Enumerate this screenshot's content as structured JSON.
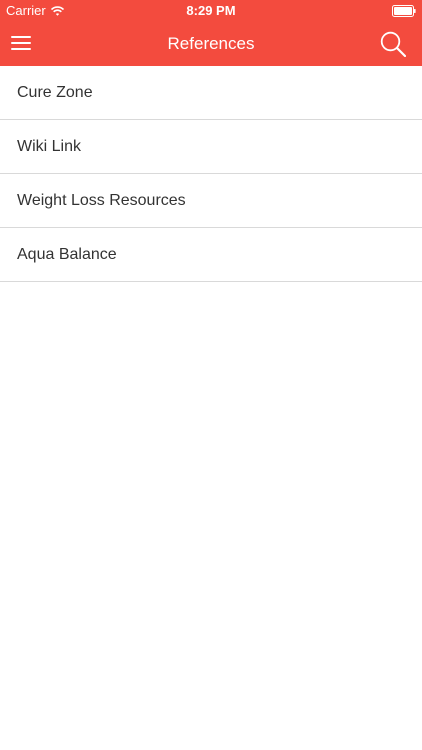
{
  "status_bar": {
    "carrier": "Carrier",
    "time": "8:29 PM",
    "wifi_icon": "wifi-icon",
    "battery_icon": "battery-icon"
  },
  "header": {
    "title": "References",
    "menu_icon": "hamburger-menu-icon",
    "search_icon": "search-icon",
    "background_color": "#f34b3e"
  },
  "references": {
    "items": [
      {
        "label": "Cure Zone"
      },
      {
        "label": "Wiki Link"
      },
      {
        "label": "Weight Loss Resources"
      },
      {
        "label": "Aqua Balance"
      }
    ]
  }
}
